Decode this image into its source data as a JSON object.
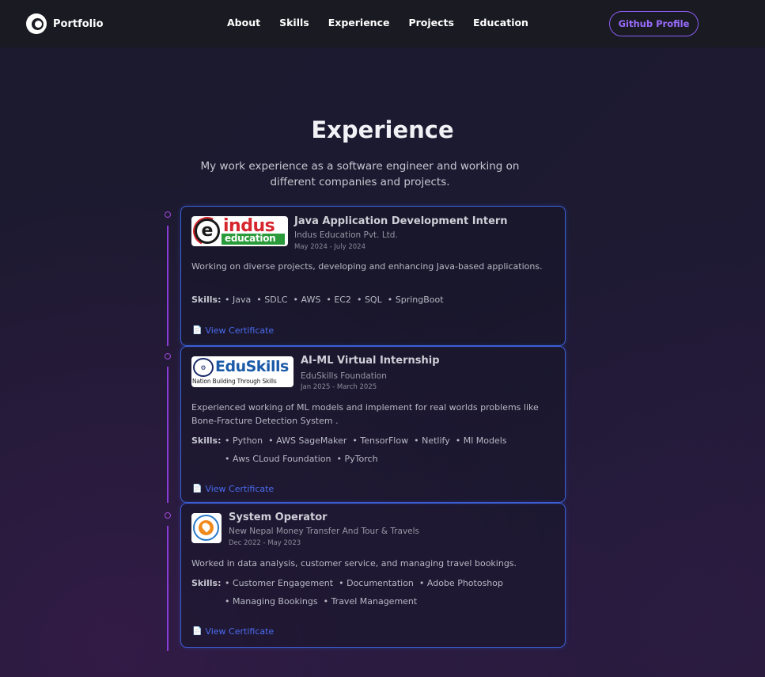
{
  "nav": {
    "brand": "Portfolio",
    "links": [
      "About",
      "Skills",
      "Experience",
      "Projects",
      "Education"
    ],
    "github_button": "Github Profile"
  },
  "header": {
    "title": "Experience",
    "subtitle": "My work experience as a software engineer and working on different companies and projects."
  },
  "experiences": [
    {
      "logo": "indus-education-logo",
      "logo_text": "indus",
      "logo_subtext": "education",
      "title": "Java Application Development Intern",
      "company": "Indus Education Pvt. Ltd.",
      "dates": "May 2024 - July 2024",
      "description": "Working on diverse projects, developing and enhancing Java-based applications.",
      "skills_label": "Skills:",
      "skills": [
        "Java",
        "SDLC",
        "AWS",
        "EC2",
        "SQL",
        "SpringBoot"
      ],
      "certificate": "View Certificate"
    },
    {
      "logo": "eduskills-logo",
      "logo_text": "EduSkills",
      "logo_subtext": "Nation Building Through Skills",
      "title": "AI-ML Virtual Internship",
      "company": "EduSkills Foundation",
      "dates": "Jan 2025 - March 2025",
      "description": "Experienced working of ML models and implement for real worlds problems like Bone-Fracture Detection System .",
      "skills_label": "Skills:",
      "skills": [
        "Python",
        "AWS SageMaker",
        "TensorFlow",
        "Netlify",
        "Ml Models",
        "Aws CLoud Foundation",
        "PyTorch"
      ],
      "certificate": "View Certificate"
    },
    {
      "logo": "nepal-money-transfer-logo",
      "title": "System Operator",
      "company": "New Nepal Money Transfer And Tour & Travels",
      "dates": "Dec 2022 - May 2023",
      "description": "Worked in data analysis, customer service, and managing travel bookings.",
      "skills_label": "Skills:",
      "skills": [
        "Customer Engagement",
        "Documentation",
        "Adobe Photoshop",
        "Managing Bookings",
        "Travel Management"
      ],
      "certificate": "View Certificate"
    }
  ],
  "colors": {
    "accent": "#8a5cf0",
    "card_border": "#3c5fd8",
    "link": "#4a6cf0",
    "timeline": "#8a3cd6"
  }
}
